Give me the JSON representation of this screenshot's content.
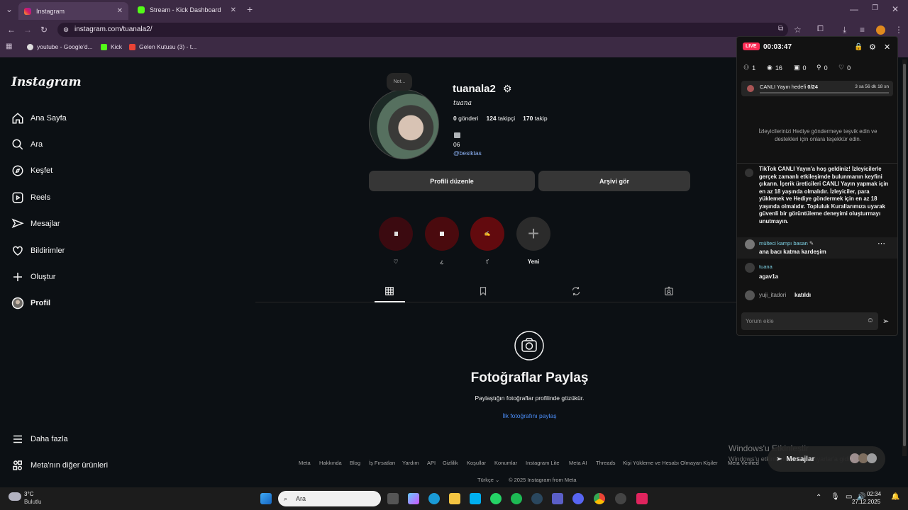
{
  "browser": {
    "tabs": [
      {
        "label": "Instagram"
      },
      {
        "label": "Stream - Kick Dashboard"
      }
    ],
    "url": "instagram.com/tuanala2/",
    "bookmarks": [
      {
        "label": "youtube - Google'd..."
      },
      {
        "label": "Kick"
      },
      {
        "label": "Gelen Kutusu (3) - t..."
      }
    ]
  },
  "sidebar": {
    "logo": "Instagram",
    "items": [
      {
        "label": "Ana Sayfa",
        "icon": "home-icon"
      },
      {
        "label": "Ara",
        "icon": "search-icon"
      },
      {
        "label": "Keşfet",
        "icon": "compass-icon"
      },
      {
        "label": "Reels",
        "icon": "reels-icon"
      },
      {
        "label": "Mesajlar",
        "icon": "messages-icon"
      },
      {
        "label": "Bildirimler",
        "icon": "heart-icon"
      },
      {
        "label": "Oluştur",
        "icon": "plus-icon"
      },
      {
        "label": "Profil",
        "icon": "avatar-icon"
      }
    ],
    "more": "Daha fazla",
    "meta": "Meta'nın diğer ürünleri"
  },
  "profile": {
    "note": "Not...",
    "username": "tuanala2",
    "fullname": "tuana",
    "posts_count": "0",
    "posts_label": "gönderi",
    "followers_count": "124",
    "followers_label": "takipçi",
    "following_count": "170",
    "following_label": "takip",
    "bio_line": "06",
    "bio_link": "@besiktas",
    "edit_button": "Profili düzenle",
    "archive_button": "Arşivi gör"
  },
  "highlights": [
    {
      "label": "♡"
    },
    {
      "label": "¿"
    },
    {
      "label": "ť"
    },
    {
      "label": "Yeni"
    }
  ],
  "empty": {
    "title": "Fotoğraflar Paylaş",
    "subtitle": "Paylaştığın fotoğraflar profilinde gözükür.",
    "link": "İlk fotoğrafını paylaş"
  },
  "footer": {
    "links": [
      "Meta",
      "Hakkında",
      "Blog",
      "İş Fırsatları",
      "Yardım",
      "API",
      "Gizlilik",
      "Koşullar",
      "Konumlar",
      "Instagram Lite",
      "Meta AI",
      "Threads",
      "Kişi Yükleme ve Hesabı Olmayan Kişiler",
      "Meta Verified"
    ],
    "language": "Türkçe",
    "copyright": "© 2025 Instagram from Meta"
  },
  "live": {
    "badge": "LIVE",
    "timer": "00:03:47",
    "stats": [
      {
        "value": "1"
      },
      {
        "value": "16"
      },
      {
        "value": "0"
      },
      {
        "value": "0"
      },
      {
        "value": "0"
      }
    ],
    "goal_label": "CANLI Yayın hedefi",
    "goal_value": "0/24",
    "goal_time": "3 sa 56 dk 18 sn",
    "gift_text": "İzleyicilerinizi Hediye göndermeye teşvik edin ve destekleri için onlara teşekkür edin.",
    "system_msg": "TikTok CANLI Yayın'a hoş geldiniz! İzleyicilerle gerçek zamanlı etkileşimde bulunmanın keyfini çıkarın. İçerik üreticileri CANLI Yayın yapmak için en az 18 yaşında olmalıdır. İzleyiciler, para yüklemek ve Hediye göndermek için en az 18 yaşında olmalıdır. Topluluk Kurallarımıza uyarak güvenli bir görüntüleme deneyimi oluşturmayı unutmayın.",
    "messages": [
      {
        "user": "mülteci kampı basan",
        "text": "ana bacı katma kardeşim"
      },
      {
        "user": "tuana",
        "text": "agav1a"
      }
    ],
    "join_user": "yuji_itadori",
    "join_text": "katıldı",
    "comment_placeholder": "Yorum ekle"
  },
  "watermark": {
    "line1": "Windows'u Etkinleştir",
    "line2": "Windows'u etkinleştirmek için Ayarlar'a gidin."
  },
  "toast": "Mesajlar",
  "taskbar": {
    "temp": "3°C",
    "weather": "Bulutlu",
    "search": "Ara",
    "time": "02:34",
    "date": "27.12.2025"
  }
}
